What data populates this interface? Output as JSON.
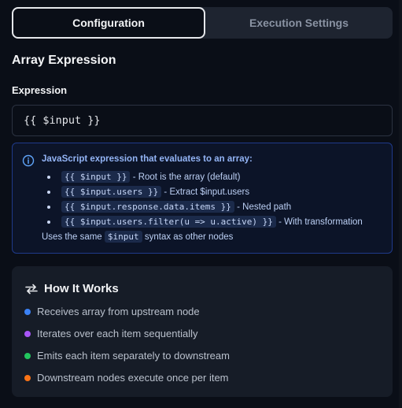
{
  "tabs": [
    {
      "label": "Configuration",
      "active": true
    },
    {
      "label": "Execution Settings",
      "active": false
    }
  ],
  "section_title": "Array Expression",
  "expression": {
    "label": "Expression",
    "value": "{{ $input }}"
  },
  "info": {
    "icon": "info-circle-icon",
    "heading": "JavaScript expression that evaluates to an array:",
    "items": [
      {
        "code": "{{ $input }}",
        "desc": "- Root is the array (default)"
      },
      {
        "code": "{{ $input.users }}",
        "desc": "- Extract $input.users"
      },
      {
        "code": "{{ $input.response.data.items }}",
        "desc": "- Nested path"
      },
      {
        "code": "{{ $input.users.filter(u => u.active) }}",
        "desc": "- With transformation"
      }
    ],
    "footer_pre": "Uses the same",
    "footer_code": "$input",
    "footer_post": "syntax as other nodes"
  },
  "how": {
    "icon": "swap-arrows-icon",
    "title": "How It Works",
    "items": [
      {
        "text": "Receives array from upstream node",
        "color": "#3b82f6"
      },
      {
        "text": "Iterates over each item sequentially",
        "color": "#a855f7"
      },
      {
        "text": "Emits each item separately to downstream",
        "color": "#22c55e"
      },
      {
        "text": "Downstream nodes execute once per item",
        "color": "#f97316"
      }
    ]
  },
  "colors": {
    "background": "#0a0e17",
    "info_border": "#1f3a8a",
    "info_text": "#93b4f5",
    "card": "#161c27"
  }
}
